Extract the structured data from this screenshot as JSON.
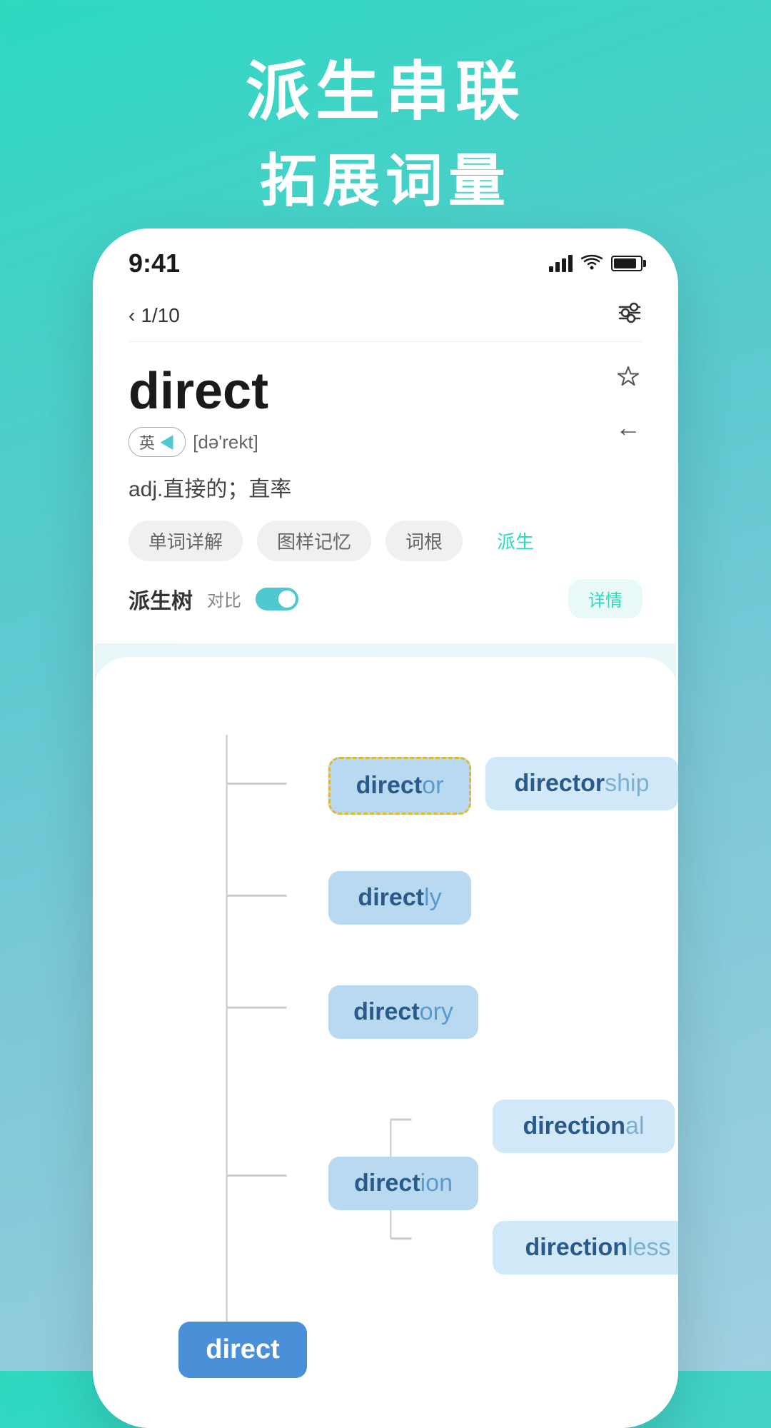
{
  "header": {
    "line1": "派生串联",
    "line2": "拓展词量"
  },
  "phone": {
    "time": "9:41",
    "nav": {
      "page": "1/10",
      "back_label": "‹",
      "filter_icon": "filter"
    },
    "word": {
      "title": "direct",
      "phonetic": "[də'rekt]",
      "lang": "英",
      "meaning": "adj.直接的；直率",
      "star_label": "☆",
      "back_arrow": "←"
    },
    "tabs": [
      {
        "label": "单词详解",
        "active": false
      },
      {
        "label": "图样记忆",
        "active": false
      },
      {
        "label": "词根",
        "active": false
      },
      {
        "label": "派生",
        "active": true
      }
    ],
    "tree_section": {
      "title": "派生树",
      "contrast_label": "对比",
      "detail_label": "详情"
    }
  },
  "tree": {
    "root": {
      "label": "direct",
      "root_part": "direct",
      "suffix": ""
    },
    "nodes": [
      {
        "id": "director",
        "root_part": "direct",
        "suffix": "or",
        "level": 1,
        "selected": true
      },
      {
        "id": "directorship",
        "root_part": "director",
        "suffix": "ship",
        "level": 2
      },
      {
        "id": "directly",
        "root_part": "direct",
        "suffix": "ly",
        "level": 1
      },
      {
        "id": "directory",
        "root_part": "direct",
        "suffix": "ory",
        "level": 1
      },
      {
        "id": "direction",
        "root_part": "direct",
        "suffix": "ion",
        "level": 1
      },
      {
        "id": "directional",
        "root_part": "direction",
        "suffix": "al",
        "level": 2
      },
      {
        "id": "directionless",
        "root_part": "direction",
        "suffix": "less",
        "level": 2
      }
    ]
  }
}
